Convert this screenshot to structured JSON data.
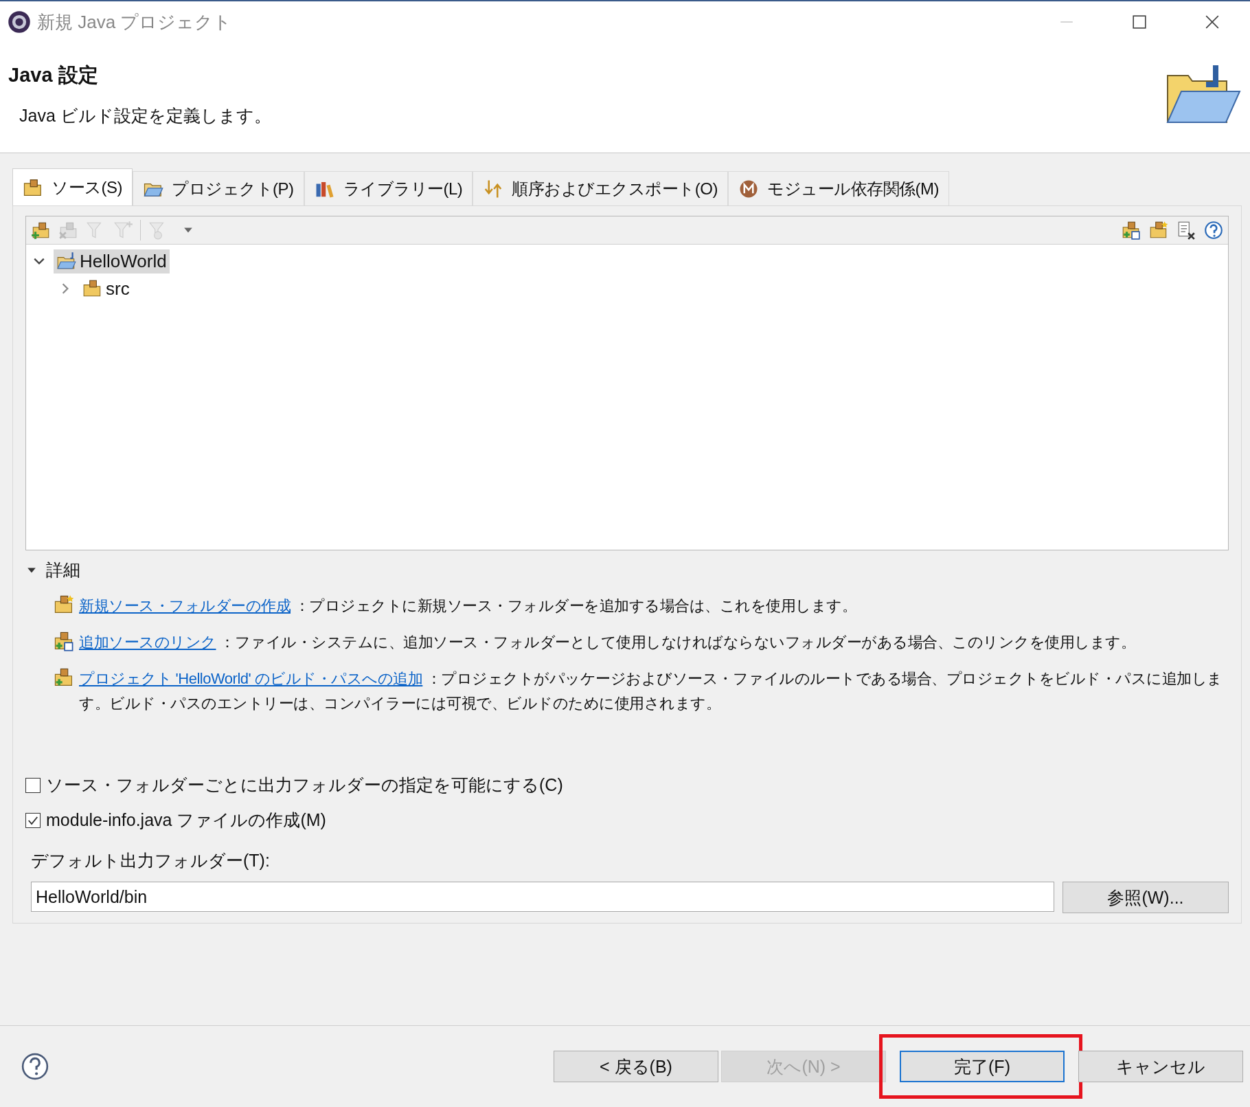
{
  "window": {
    "title": "新規 Java プロジェクト"
  },
  "header": {
    "title": "Java 設定",
    "description": "Java ビルド設定を定義します。"
  },
  "tabs": [
    {
      "label": "ソース(S)",
      "selected": true,
      "kind": "package"
    },
    {
      "label": "プロジェクト(P)",
      "selected": false,
      "kind": "folder"
    },
    {
      "label": "ライブラリー(L)",
      "selected": false,
      "kind": "books"
    },
    {
      "label": "順序およびエクスポート(O)",
      "selected": false,
      "kind": "order"
    },
    {
      "label": "モジュール依存関係(M)",
      "selected": false,
      "kind": "module"
    }
  ],
  "toolbar": {
    "left": [
      {
        "kind": "add",
        "disabled": false
      },
      {
        "kind": "remove",
        "disabled": true
      },
      {
        "kind": "filter",
        "disabled": true
      },
      {
        "kind": "filter-add",
        "disabled": true
      },
      {
        "kind": "filter-clear",
        "disabled": true
      },
      {
        "kind": "dropdown"
      }
    ],
    "right": [
      {
        "kind": "link",
        "disabled": false
      },
      {
        "kind": "new",
        "disabled": false
      },
      {
        "kind": "delete",
        "disabled": false
      },
      {
        "kind": "help",
        "disabled": false
      }
    ]
  },
  "tree": [
    {
      "label": "HelloWorld",
      "kind": "project",
      "expanded": true,
      "selected": true,
      "children": [
        {
          "label": "src",
          "kind": "package",
          "expanded": false,
          "selected": false
        }
      ]
    }
  ],
  "details": {
    "title": "詳細",
    "expanded": true,
    "items": [
      {
        "kind": "new",
        "link": "新規ソース・フォルダーの作成",
        "text": "：プロジェクトに新規ソース・フォルダーを追加する場合は、これを使用します。"
      },
      {
        "kind": "link",
        "link": "追加ソースのリンク",
        "text": "：ファイル・システムに、追加ソース・フォルダーとして使用しなければならないフォルダーがある場合、このリンクを使用します。"
      },
      {
        "kind": "add",
        "link": "プロジェクト 'HelloWorld' のビルド・パスへの追加",
        "text": "：プロジェクトがパッケージおよびソース・ファイルのルートである場合、プロジェクトをビルド・パスに追加します。ビルド・パスのエントリーは、コンパイラーには可視で、ビルドのために使用されます。"
      }
    ]
  },
  "options": [
    {
      "label": "ソース・フォルダーごとに出力フォルダーの指定を可能にする(C)",
      "checked": false
    },
    {
      "label": "module-info.java ファイルの作成(M)",
      "checked": true
    }
  ],
  "output_folder": {
    "label": "デフォルト出力フォルダー(T):",
    "value": "HelloWorld/bin",
    "browse": "参照(W)..."
  },
  "buttons": [
    {
      "label": "< 戻る(B)",
      "disabled": false,
      "default": false
    },
    {
      "label": "次へ(N) >",
      "disabled": true,
      "default": false
    },
    {
      "label": "完了(F)",
      "disabled": false,
      "default": true,
      "highlighted": true
    },
    {
      "label": "キャンセル",
      "disabled": false,
      "default": false
    }
  ]
}
